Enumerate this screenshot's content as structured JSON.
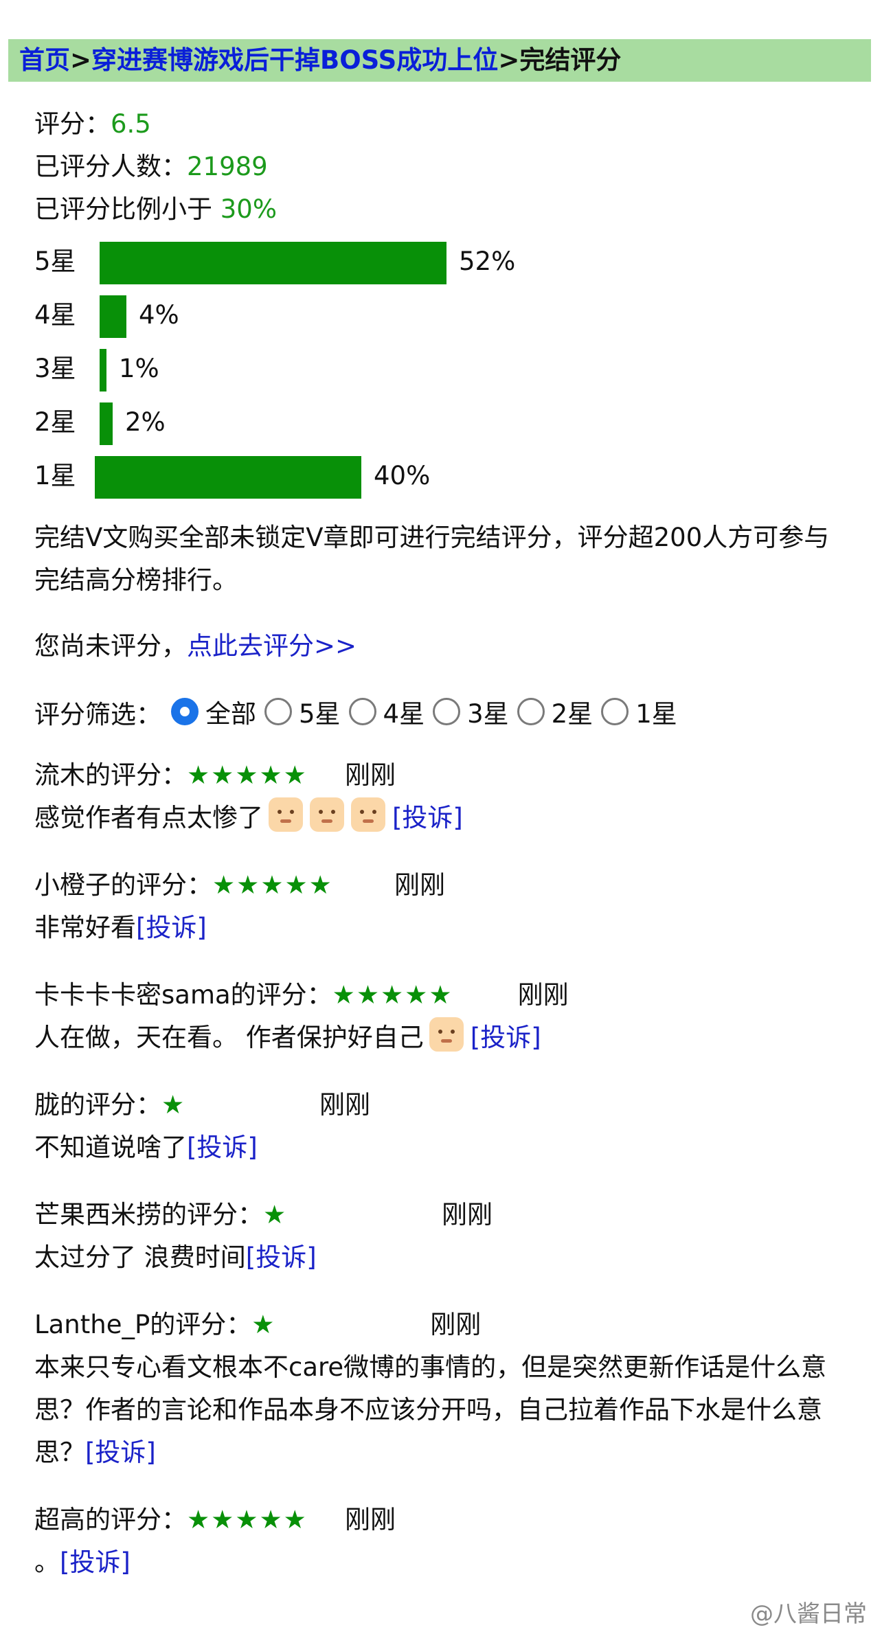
{
  "breadcrumb": {
    "home": "首页",
    "sep1": ">",
    "book": "穿进赛博游戏后干掉BOSS成功上位",
    "sep2": ">",
    "current": "完结评分"
  },
  "rating": {
    "score_label": "评分：",
    "score": "6.5",
    "count_label": "已评分人数：",
    "count": "21989",
    "ratio_label": "已评分比例小于 ",
    "ratio": "30%"
  },
  "distribution": [
    {
      "label": "5星",
      "pct_text": "52%",
      "fraction": 0.52
    },
    {
      "label": "4星",
      "pct_text": "4%",
      "fraction": 0.04
    },
    {
      "label": "3星",
      "pct_text": "1%",
      "fraction": 0.01
    },
    {
      "label": "2星",
      "pct_text": "2%",
      "fraction": 0.02
    },
    {
      "label": "1星",
      "pct_text": "40%",
      "fraction": 0.4
    }
  ],
  "notice": "完结V文购买全部未锁定V章即可进行完结评分，评分超200人方可参与完结高分榜排行。",
  "unrated": {
    "text": "您尚未评分，",
    "link": "点此去评分>>"
  },
  "filter": {
    "label": "评分筛选：",
    "options": [
      "全部",
      "5星",
      "4星",
      "3星",
      "2星",
      "1星"
    ],
    "selected": "全部"
  },
  "reviews": [
    {
      "head": "流木的评分：",
      "stars": "★★★★★",
      "time": "刚刚",
      "body": "感觉作者有点太惨了",
      "emojis": 3,
      "complaint": "[投诉]"
    },
    {
      "head": "小橙子的评分：",
      "stars": "★★★★★",
      "time": "刚刚",
      "body": "非常好看",
      "emojis": 0,
      "complaint": "[投诉]"
    },
    {
      "head": "卡卡卡卡密sama的评分：",
      "stars": "★★★★★",
      "time": "刚刚",
      "body": "人在做，天在看。 作者保护好自己",
      "emojis": 1,
      "complaint": "[投诉]"
    },
    {
      "head": "胧的评分：",
      "stars": "★",
      "time": "刚刚",
      "body": "不知道说啥了",
      "emojis": 0,
      "complaint": "[投诉]"
    },
    {
      "head": "芒果西米捞的评分：",
      "stars": "★",
      "time": "刚刚",
      "body": "太过分了 浪费时间",
      "emojis": 0,
      "complaint": "[投诉]"
    },
    {
      "head": "Lanthe_P的评分：",
      "stars": "★",
      "time": "刚刚",
      "body": "本来只专心看文根本不care微博的事情的，但是突然更新作话是什么意思？作者的言论和作品本身不应该分开吗，自己拉着作品下水是什么意思？",
      "emojis": 0,
      "complaint": "[投诉]"
    },
    {
      "head": "超高的评分：",
      "stars": "★★★★★",
      "time": "刚刚",
      "body": "。",
      "emojis": 0,
      "complaint": "[投诉]"
    }
  ],
  "watermark": "@八酱日常",
  "colors": {
    "accent_green": "#089008",
    "link_blue": "#1a22c8",
    "breadcrumb_bg": "#a8dca0"
  }
}
